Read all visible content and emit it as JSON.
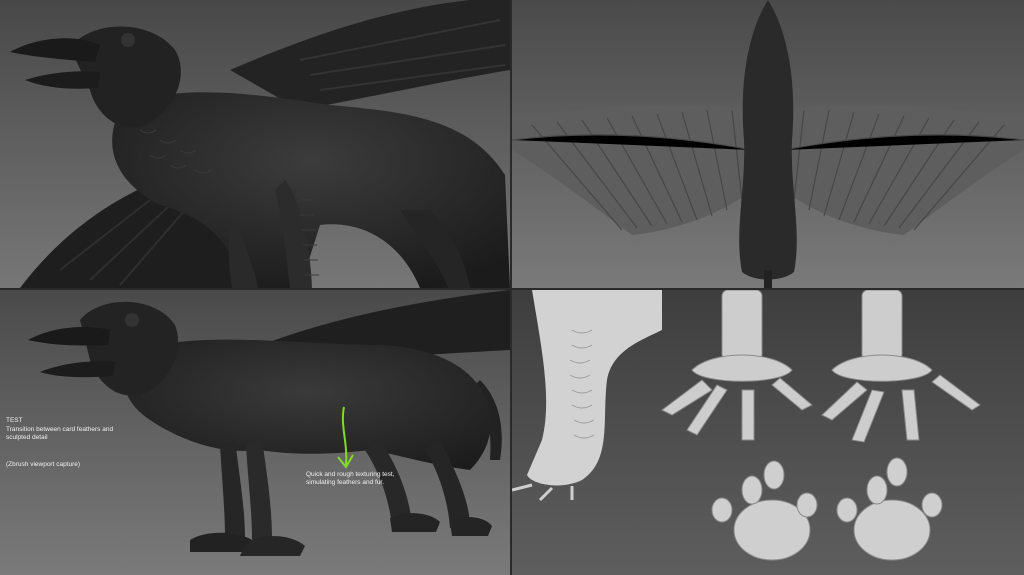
{
  "annotations": {
    "title": "TEST",
    "transition": "Transition between card feathers and sculpted detail",
    "zbrush": "(Zbrush viewport capture)",
    "quick": "Quick and rough texturing test, simulating feathers and fur."
  },
  "colors": {
    "arrow": "#7fdc2a",
    "sculpt_dark": "#262626",
    "sculpt_light": "#cfcfcf"
  }
}
